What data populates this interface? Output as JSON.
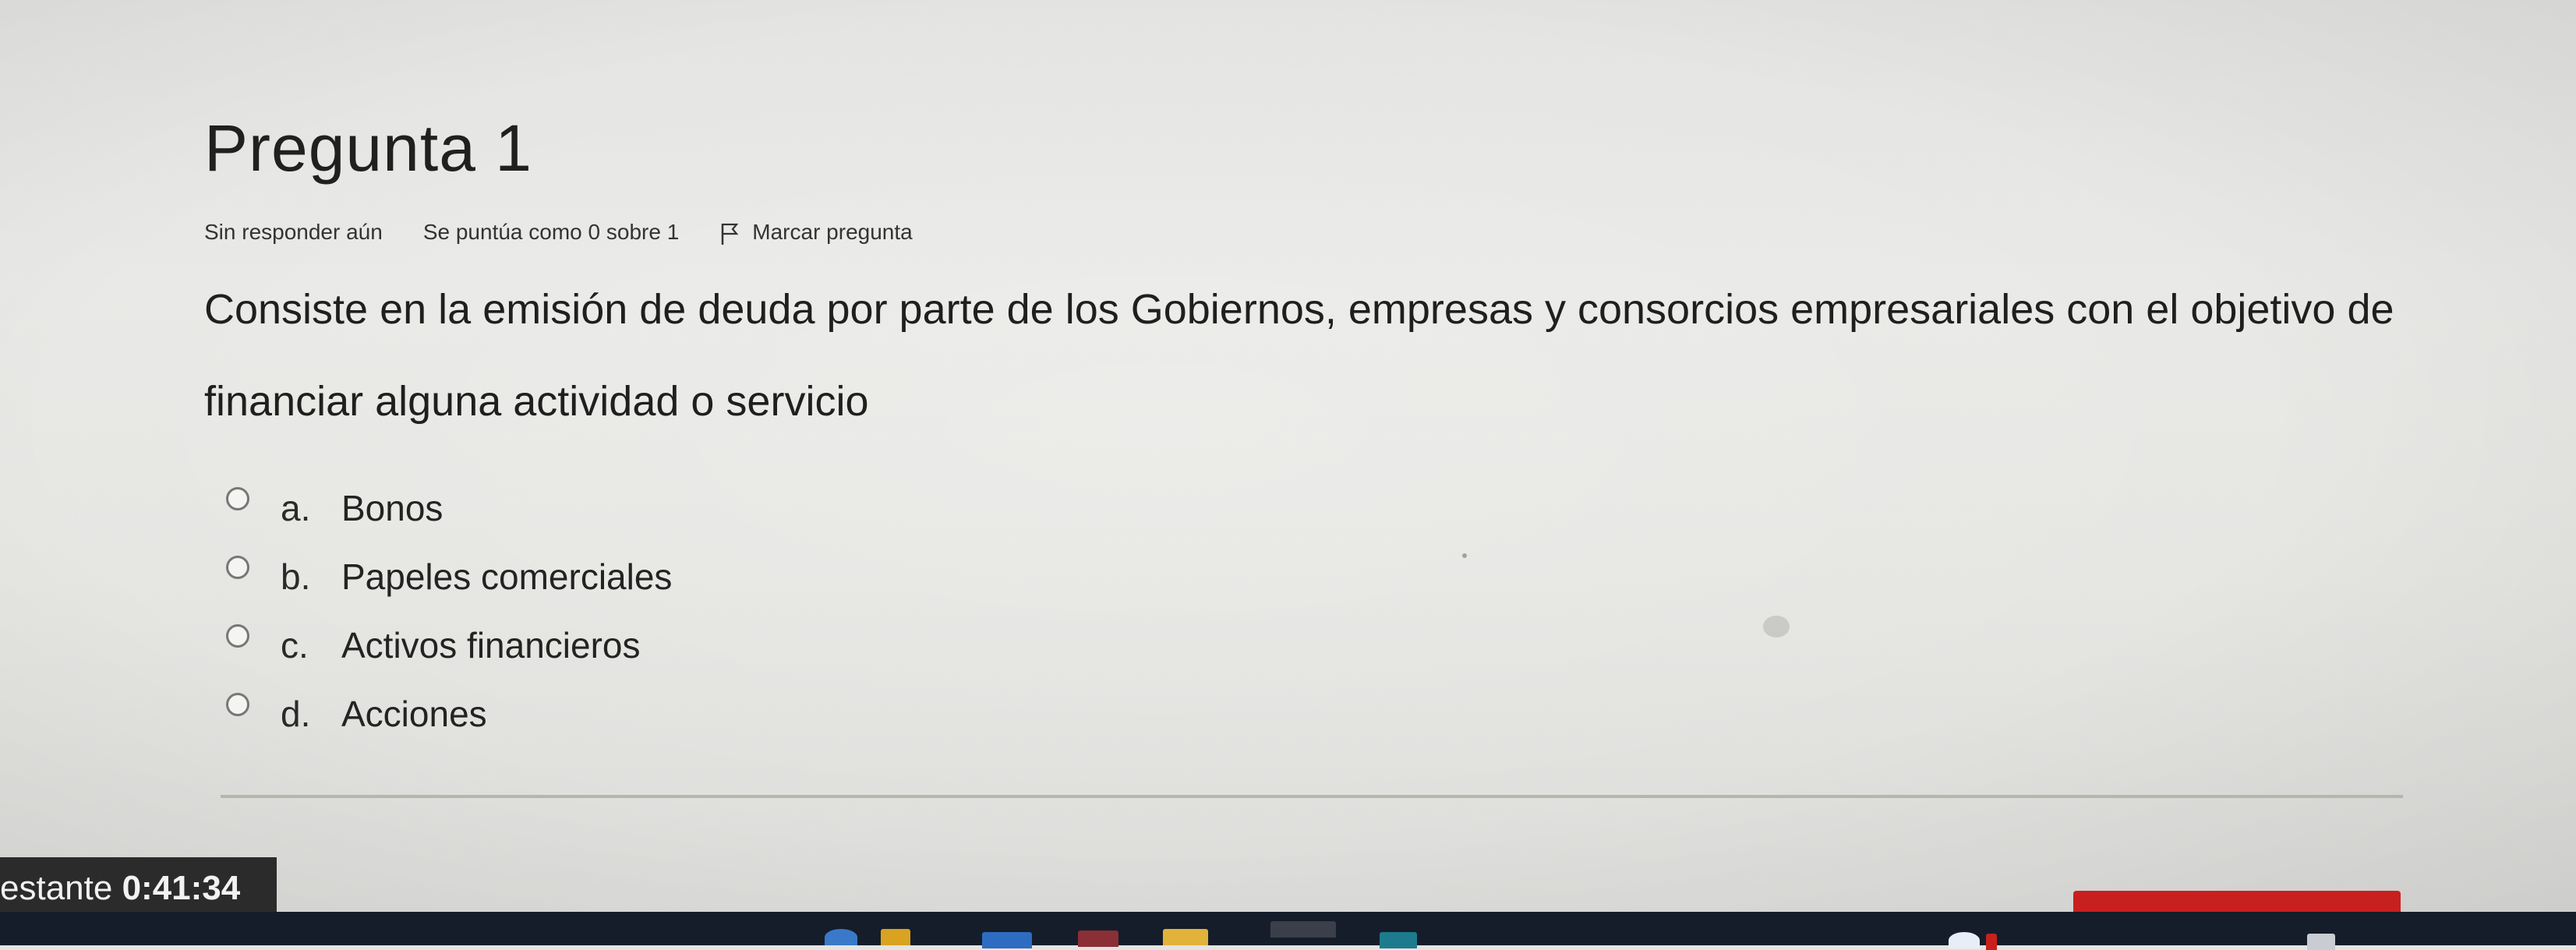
{
  "question": {
    "title": "Pregunta 1",
    "status": "Sin responder aún",
    "score": "Se puntúa como 0 sobre 1",
    "flag_label": "Marcar pregunta",
    "text": "Consiste en la emisión de deuda por parte de los Gobiernos, empresas y consorcios empresariales con el objetivo de financiar alguna actividad o servicio"
  },
  "answers": [
    {
      "letter": "a.",
      "label": "Bonos"
    },
    {
      "letter": "b.",
      "label": "Papeles comerciales"
    },
    {
      "letter": "c.",
      "label": "Activos financieros"
    },
    {
      "letter": "d.",
      "label": "Acciones"
    }
  ],
  "timer": {
    "label": "estante",
    "time": "0:41:34"
  },
  "colors": {
    "taskbar": "#151d2a",
    "timer_bg": "#2b2b2b",
    "accent_red": "#c8201e"
  }
}
